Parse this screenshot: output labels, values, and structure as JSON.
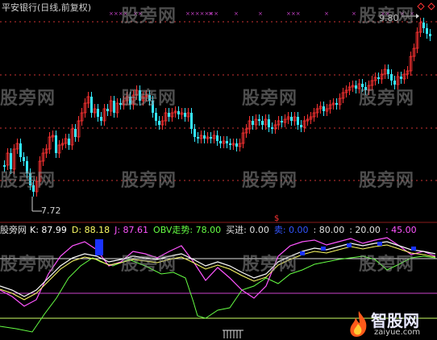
{
  "title": "平安银行(日线,前复权)",
  "watermark": "股旁网",
  "price": {
    "high_label": "9.80",
    "low_label": "7.72"
  },
  "indicator": {
    "name": "股旁网",
    "k": "K: 87.99",
    "d": "D: 88.18",
    "j": "J: 87.61",
    "obv": "OBV走势: 78.00",
    "buy": "买进: 0.00",
    "sell": "卖: 0.00",
    "l80": ": 80.00",
    "l20": ": 20.00",
    "l45": ": 45.00"
  },
  "logo": {
    "name": "智股网",
    "url": "zaiyue.com"
  },
  "colors": {
    "up": "#ff3333",
    "down": "#33e6ff",
    "k_line": "#ffffff",
    "d_line": "#ffff66",
    "j_line": "#ff55ff",
    "obv_line": "#66ff44",
    "ref_line": "#cc44cc",
    "dash_line": "#cc3333"
  },
  "chart_data": {
    "type": "candlestick",
    "y_range": [
      7.4,
      10.0
    ],
    "price_high": 9.8,
    "price_low": 7.72,
    "indicator_levels": [
      80,
      45,
      20
    ]
  }
}
